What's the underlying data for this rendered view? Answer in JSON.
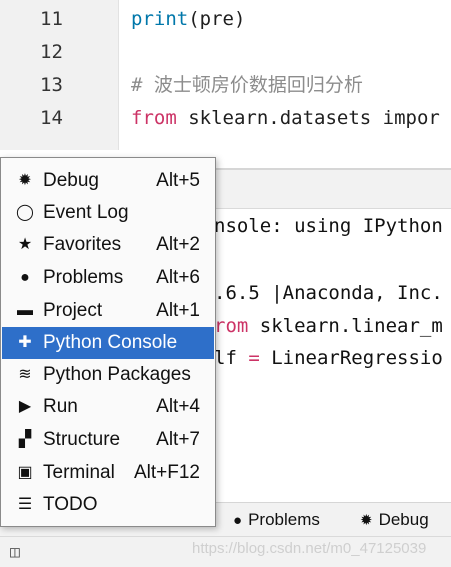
{
  "editor": {
    "lines": [
      {
        "num": "11",
        "code_fn": "print",
        "code_rest": "(pre)"
      },
      {
        "num": "12"
      },
      {
        "num": "13",
        "comment": "# 波士顿房价数据回归分析"
      },
      {
        "num": "14",
        "kw": "from",
        "rest": " sklearn.datasets impor"
      }
    ]
  },
  "console": {
    "line1": "nsole: using IPython",
    "line2": ".6.5 |Anaconda, Inc.",
    "line3_kw": "rom",
    "line3_rest": " sklearn.linear_m",
    "line4_a": "lf",
    "line4_eq": " = ",
    "line4_b": "LinearRegressio"
  },
  "menu": {
    "items": [
      {
        "label": "Debug",
        "shortcut": "Alt+5",
        "icon": "bug-icon",
        "glyph": "✹"
      },
      {
        "label": "Event Log",
        "shortcut": "",
        "icon": "event-log-icon",
        "glyph": "◯"
      },
      {
        "label": "Favorites",
        "shortcut": "Alt+2",
        "icon": "star-icon",
        "glyph": "★"
      },
      {
        "label": "Problems",
        "shortcut": "Alt+6",
        "icon": "problems-icon",
        "glyph": "●"
      },
      {
        "label": "Project",
        "shortcut": "Alt+1",
        "icon": "folder-icon",
        "glyph": "▬"
      },
      {
        "label": "Python Console",
        "shortcut": "",
        "icon": "python-icon",
        "glyph": "✚"
      },
      {
        "label": "Python Packages",
        "shortcut": "",
        "icon": "layers-icon",
        "glyph": "≋"
      },
      {
        "label": "Run",
        "shortcut": "Alt+4",
        "icon": "run-icon",
        "glyph": "▶"
      },
      {
        "label": "Structure",
        "shortcut": "Alt+7",
        "icon": "structure-icon",
        "glyph": "▞"
      },
      {
        "label": "Terminal",
        "shortcut": "Alt+F12",
        "icon": "terminal-icon",
        "glyph": "▣"
      },
      {
        "label": "TODO",
        "shortcut": "",
        "icon": "todo-icon",
        "glyph": "☰"
      }
    ],
    "selected_index": 5,
    "selected_color": "#2e6fc9"
  },
  "bottom_tabs": {
    "problems": "Problems",
    "debug": "Debug"
  },
  "watermark": "https://blog.csdn.net/m0_47125039"
}
